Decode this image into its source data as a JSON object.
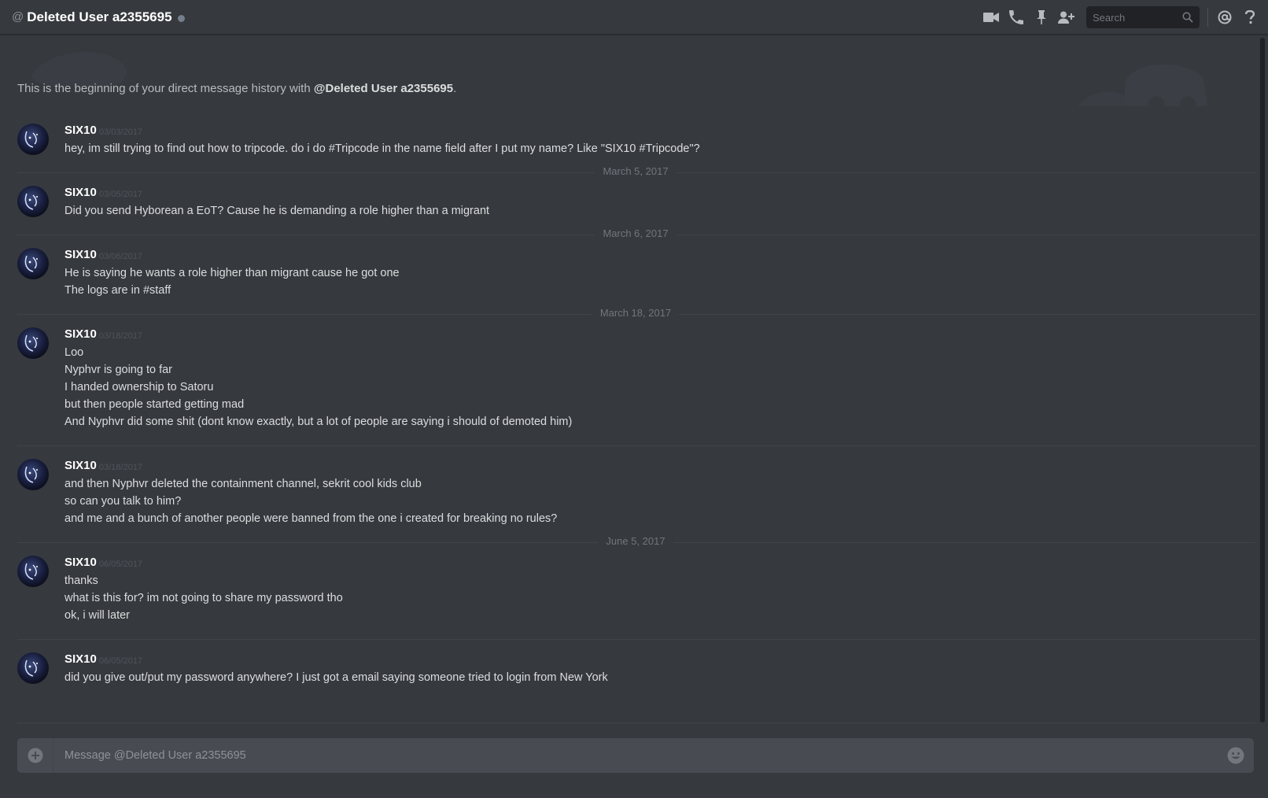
{
  "header": {
    "at_symbol": "@",
    "title": "Deleted User a2355695",
    "search_placeholder": "Search",
    "icons": [
      "video-call-icon",
      "phone-icon",
      "pin-icon",
      "add-friend-icon",
      "search-icon",
      "mention-icon",
      "help-icon"
    ]
  },
  "intro": {
    "prefix": "This is the beginning of your direct message history with ",
    "mention": "@Deleted User a2355695",
    "suffix": "."
  },
  "messages": [
    {
      "author": "SIX10",
      "timestamp": "03/03/2017",
      "lines": [
        "hey, im still trying to find out how to tripcode. do i do #Tripcode in the name field after I put my name? Like \"SIX10 #Tripcode\"?"
      ]
    },
    {
      "author": "SIX10",
      "timestamp": "03/05/2017",
      "lines": [
        "Did you send Hyborean a EoT? Cause he is demanding a role higher than a migrant"
      ]
    },
    {
      "author": "SIX10",
      "timestamp": "03/06/2017",
      "lines": [
        "He is saying he wants a role higher than migrant cause he got one",
        "The logs are in #staff"
      ]
    },
    {
      "author": "SIX10",
      "timestamp": "03/18/2017",
      "lines": [
        "Loo",
        "Nyphvr is going to far",
        "I handed ownership to Satoru",
        "but then people started getting mad",
        "And Nyphvr did some shit (dont know exactly, but a lot of people are saying i should of demoted him)"
      ]
    },
    {
      "author": "SIX10",
      "timestamp": "03/18/2017",
      "lines": [
        "and then Nyphvr deleted the containment channel, sekrit cool kids club",
        "so can you talk to him?",
        "and me and a bunch of another people were banned from the one i created for breaking no rules?"
      ]
    },
    {
      "author": "SIX10",
      "timestamp": "06/05/2017",
      "lines": [
        "thanks",
        "what is this for? im not going to share my password tho",
        "ok, i will later"
      ]
    },
    {
      "author": "SIX10",
      "timestamp": "06/05/2017",
      "lines": [
        "did you give out/put my password anywhere? I just got a email saying someone tried to login from New York"
      ]
    }
  ],
  "date_dividers": [
    "March 5, 2017",
    "March 6, 2017",
    "March 18, 2017",
    "June 5, 2017"
  ],
  "composer": {
    "placeholder": "Message @Deleted User a2355695"
  },
  "colors": {
    "background": "#36393e",
    "header_text": "#ffffff",
    "message_text": "#dcddde",
    "timestamp": "#4f545c",
    "divider_label": "#72767d",
    "input_bg": "#484c52"
  }
}
